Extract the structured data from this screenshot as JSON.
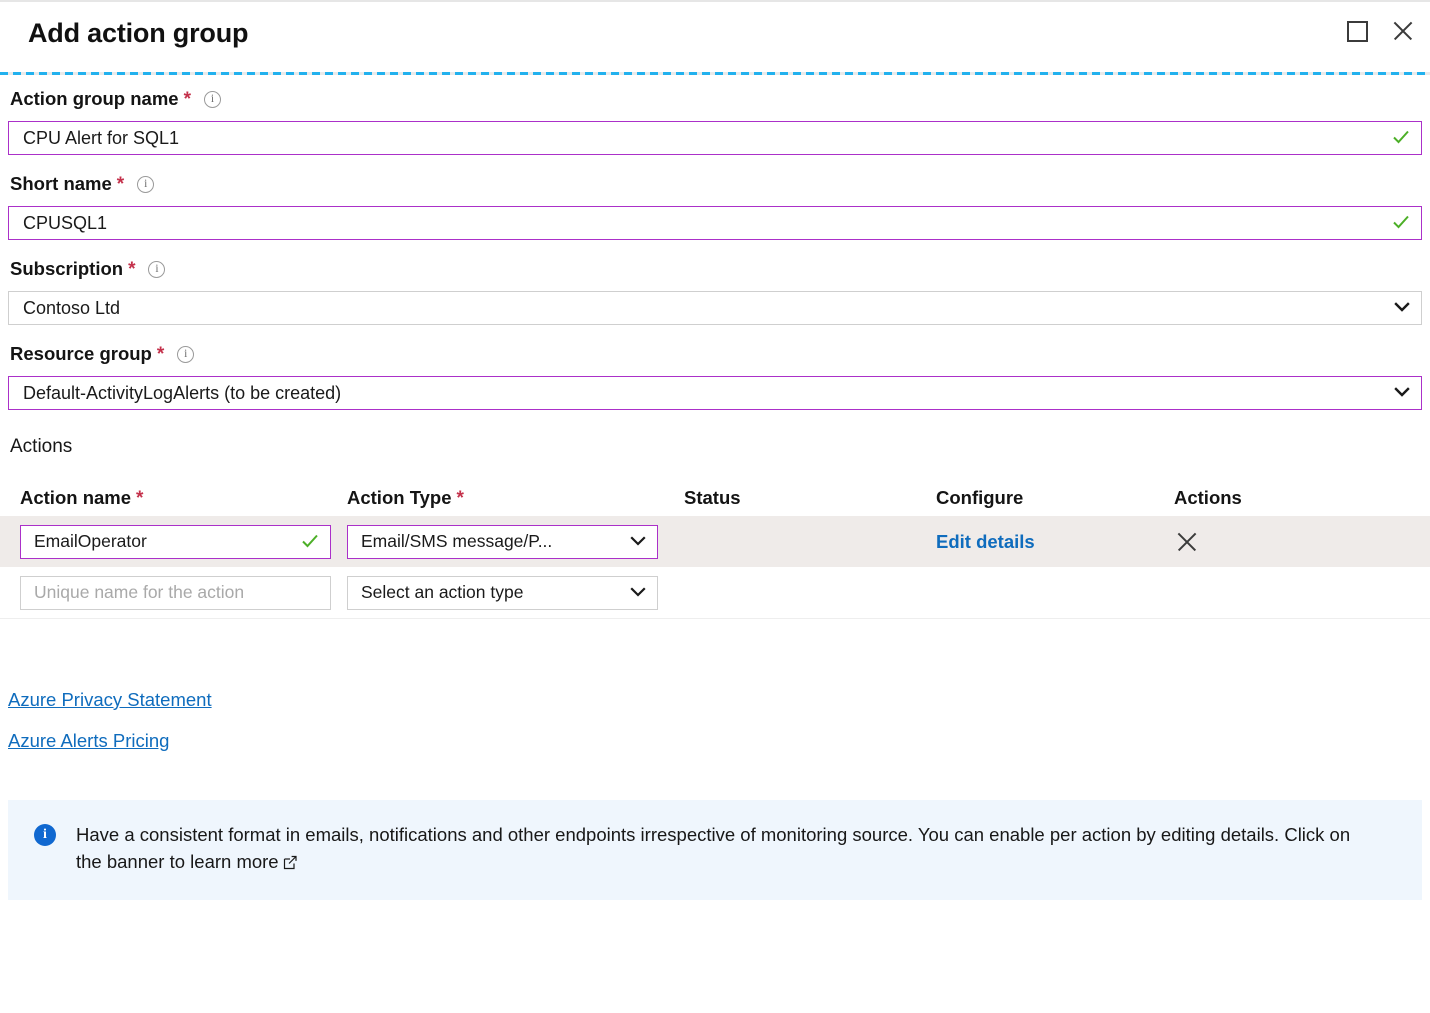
{
  "header": {
    "title": "Add action group",
    "maximize_label": "maximize",
    "close_label": "close"
  },
  "form": {
    "fields": [
      {
        "label": "Action group name",
        "required_mark": "*",
        "info": "i",
        "value": "CPU Alert for SQL1",
        "placeholder": "",
        "state": "valid-focus",
        "control": "text"
      },
      {
        "label": "Short name",
        "required_mark": "*",
        "info": "i",
        "value": "CPUSQL1",
        "placeholder": "",
        "state": "valid-focus",
        "control": "text"
      },
      {
        "label": "Subscription",
        "required_mark": "*",
        "info": "i",
        "value": "Contoso Ltd",
        "placeholder": "",
        "state": "normal",
        "control": "select"
      },
      {
        "label": "Resource group",
        "required_mark": "*",
        "info": "i",
        "value": "Default-ActivityLogAlerts (to be created)",
        "placeholder": "",
        "state": "focus",
        "control": "select"
      }
    ]
  },
  "actions_section": {
    "heading": "Actions",
    "columns": {
      "action_name": "Action name",
      "action_name_required": "*",
      "action_type": "Action Type",
      "action_type_required": "*",
      "status": "Status",
      "configure": "Configure",
      "actions": "Actions"
    },
    "rows": [
      {
        "name_value": "EmailOperator",
        "name_placeholder": "",
        "type_value": "Email/SMS message/P...",
        "status": "",
        "configure_link": "Edit details",
        "delete_label": "delete-action"
      },
      {
        "name_value": "",
        "name_placeholder": "Unique name for the action",
        "type_value": "Select an action type",
        "status": "",
        "configure_link": "",
        "delete_label": ""
      }
    ]
  },
  "links": [
    {
      "label": "Azure Privacy Statement"
    },
    {
      "label": "Azure Alerts Pricing"
    }
  ],
  "banner": {
    "icon": "info-icon",
    "text": "Have a consistent format in emails, notifications and other endpoints irrespective of monitoring source. You can enable per action by editing details. Click on the banner to learn more",
    "external_link_icon": "external-link-icon"
  },
  "colors": {
    "focus_purple": "#ab30c9",
    "link_blue": "#0f6cbd",
    "required_red": "#c4314b",
    "valid_green": "#4caf27",
    "banner_bg": "#eff6fd",
    "row_filled_bg": "#efebe9",
    "divider_cyan": "#22b1ee"
  }
}
